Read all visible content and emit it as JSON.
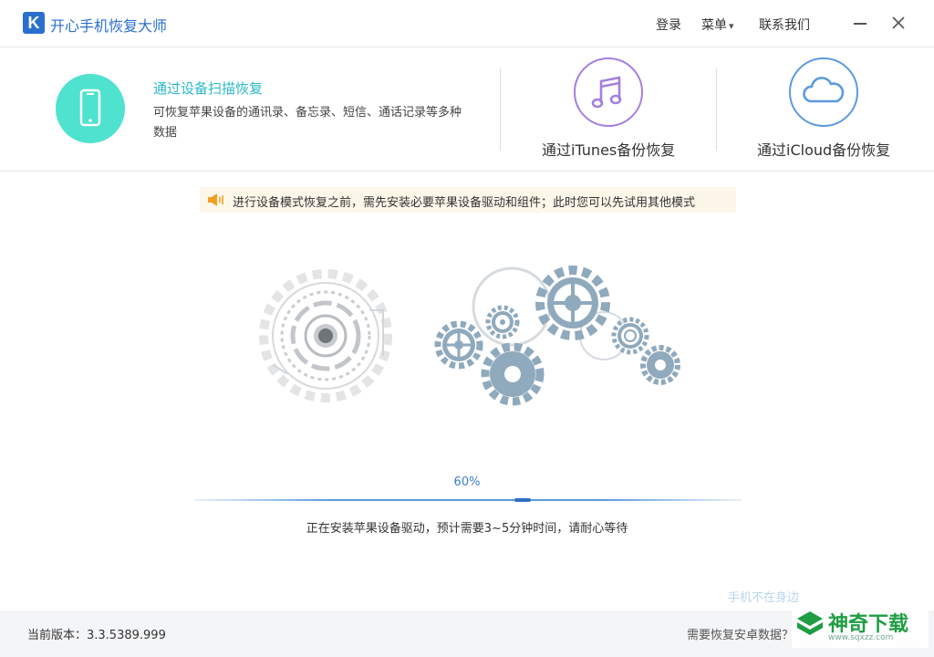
{
  "app": {
    "logo_letter": "K",
    "title": "开心手机恢复大师"
  },
  "titlebar": {
    "login": "登录",
    "menu": "菜单",
    "menu_arrow": "▾",
    "contact": "联系我们"
  },
  "modes": {
    "device": {
      "title": "通过设备扫描恢复",
      "description": "可恢复苹果设备的通讯录、备忘录、短信、通话记录等多种数据",
      "icon": "phone-icon",
      "color": "#4ee2cf"
    },
    "itunes": {
      "label": "通过iTunes备份恢复",
      "icon": "music-note-icon",
      "color": "#a47fe0"
    },
    "icloud": {
      "label": "通过iCloud备份恢复",
      "icon": "cloud-icon",
      "color": "#5b9ae0"
    }
  },
  "notice": {
    "text": "进行设备模式恢复之前，需先安装必要苹果设备驱动和组件；此时您可以先试用其他模式",
    "icon": "speaker-icon"
  },
  "progress": {
    "percent_label": "60%",
    "value": 0.6,
    "status": "正在安装苹果设备驱动，预计需要3~5分钟时间，请耐心等待"
  },
  "side_note": "手机不在身边",
  "footer": {
    "version": "当前版本：3.3.5389.999",
    "android_link": "需要恢复安卓数据？"
  },
  "watermark": {
    "text": "神奇下载",
    "sub": "www.sqxzz.com"
  },
  "colors": {
    "accent": "#2a6fd0",
    "teal": "#4ee2cf",
    "gear": "#8fa9bd",
    "gear_light": "#d4d8dc"
  }
}
